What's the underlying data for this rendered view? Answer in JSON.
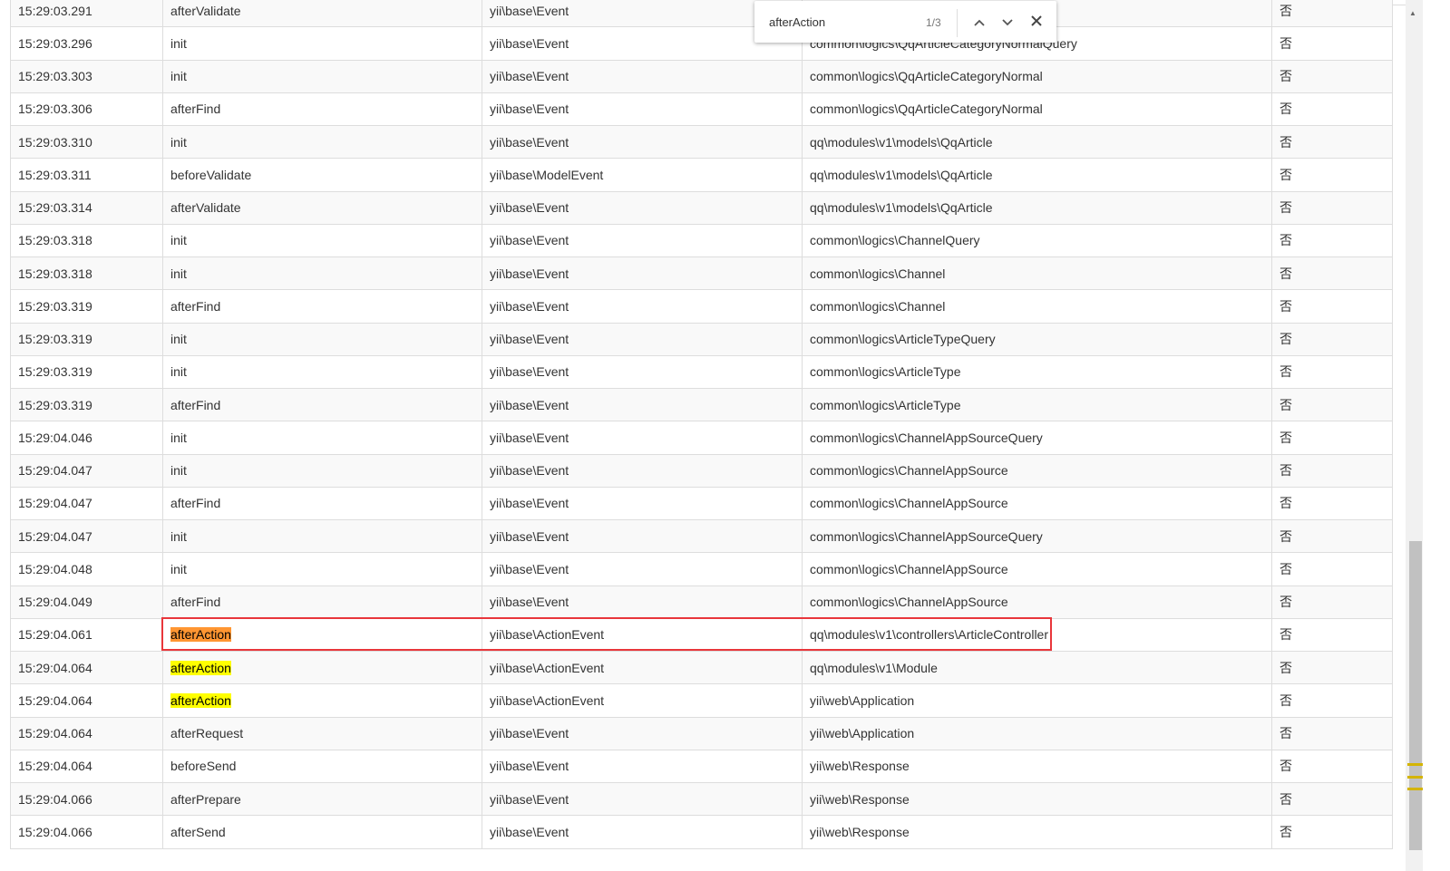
{
  "find_bar": {
    "query": "afterAction",
    "count": "1/3",
    "prev_icon": "chevron-up-icon",
    "next_icon": "chevron-down-icon",
    "close_icon": "close-icon"
  },
  "colors": {
    "match": "#ffff00",
    "current_match": "#ff9632",
    "selection_box": "#e8363b"
  },
  "rows": [
    {
      "time": "15:29:03.291",
      "name": "afterValidate",
      "class": "yii\\base\\Event",
      "sender": "",
      "static": "否"
    },
    {
      "time": "15:29:03.296",
      "name": "init",
      "class": "yii\\base\\Event",
      "sender": "common\\logics\\QqArticleCategoryNormalQuery",
      "static": "否"
    },
    {
      "time": "15:29:03.303",
      "name": "init",
      "class": "yii\\base\\Event",
      "sender": "common\\logics\\QqArticleCategoryNormal",
      "static": "否"
    },
    {
      "time": "15:29:03.306",
      "name": "afterFind",
      "class": "yii\\base\\Event",
      "sender": "common\\logics\\QqArticleCategoryNormal",
      "static": "否"
    },
    {
      "time": "15:29:03.310",
      "name": "init",
      "class": "yii\\base\\Event",
      "sender": "qq\\modules\\v1\\models\\QqArticle",
      "static": "否"
    },
    {
      "time": "15:29:03.311",
      "name": "beforeValidate",
      "class": "yii\\base\\ModelEvent",
      "sender": "qq\\modules\\v1\\models\\QqArticle",
      "static": "否"
    },
    {
      "time": "15:29:03.314",
      "name": "afterValidate",
      "class": "yii\\base\\Event",
      "sender": "qq\\modules\\v1\\models\\QqArticle",
      "static": "否"
    },
    {
      "time": "15:29:03.318",
      "name": "init",
      "class": "yii\\base\\Event",
      "sender": "common\\logics\\ChannelQuery",
      "static": "否"
    },
    {
      "time": "15:29:03.318",
      "name": "init",
      "class": "yii\\base\\Event",
      "sender": "common\\logics\\Channel",
      "static": "否"
    },
    {
      "time": "15:29:03.319",
      "name": "afterFind",
      "class": "yii\\base\\Event",
      "sender": "common\\logics\\Channel",
      "static": "否"
    },
    {
      "time": "15:29:03.319",
      "name": "init",
      "class": "yii\\base\\Event",
      "sender": "common\\logics\\ArticleTypeQuery",
      "static": "否"
    },
    {
      "time": "15:29:03.319",
      "name": "init",
      "class": "yii\\base\\Event",
      "sender": "common\\logics\\ArticleType",
      "static": "否"
    },
    {
      "time": "15:29:03.319",
      "name": "afterFind",
      "class": "yii\\base\\Event",
      "sender": "common\\logics\\ArticleType",
      "static": "否"
    },
    {
      "time": "15:29:04.046",
      "name": "init",
      "class": "yii\\base\\Event",
      "sender": "common\\logics\\ChannelAppSourceQuery",
      "static": "否"
    },
    {
      "time": "15:29:04.047",
      "name": "init",
      "class": "yii\\base\\Event",
      "sender": "common\\logics\\ChannelAppSource",
      "static": "否"
    },
    {
      "time": "15:29:04.047",
      "name": "afterFind",
      "class": "yii\\base\\Event",
      "sender": "common\\logics\\ChannelAppSource",
      "static": "否"
    },
    {
      "time": "15:29:04.047",
      "name": "init",
      "class": "yii\\base\\Event",
      "sender": "common\\logics\\ChannelAppSourceQuery",
      "static": "否"
    },
    {
      "time": "15:29:04.048",
      "name": "init",
      "class": "yii\\base\\Event",
      "sender": "common\\logics\\ChannelAppSource",
      "static": "否"
    },
    {
      "time": "15:29:04.049",
      "name": "afterFind",
      "class": "yii\\base\\Event",
      "sender": "common\\logics\\ChannelAppSource",
      "static": "否"
    },
    {
      "time": "15:29:04.061",
      "name": "afterAction",
      "class": "yii\\base\\ActionEvent",
      "sender": "qq\\modules\\v1\\controllers\\ArticleController",
      "static": "否",
      "match": "current"
    },
    {
      "time": "15:29:04.064",
      "name": "afterAction",
      "class": "yii\\base\\ActionEvent",
      "sender": "qq\\modules\\v1\\Module",
      "static": "否",
      "match": "yes"
    },
    {
      "time": "15:29:04.064",
      "name": "afterAction",
      "class": "yii\\base\\ActionEvent",
      "sender": "yii\\web\\Application",
      "static": "否",
      "match": "yes"
    },
    {
      "time": "15:29:04.064",
      "name": "afterRequest",
      "class": "yii\\base\\Event",
      "sender": "yii\\web\\Application",
      "static": "否"
    },
    {
      "time": "15:29:04.064",
      "name": "beforeSend",
      "class": "yii\\base\\Event",
      "sender": "yii\\web\\Response",
      "static": "否"
    },
    {
      "time": "15:29:04.066",
      "name": "afterPrepare",
      "class": "yii\\base\\Event",
      "sender": "yii\\web\\Response",
      "static": "否"
    },
    {
      "time": "15:29:04.066",
      "name": "afterSend",
      "class": "yii\\base\\Event",
      "sender": "yii\\web\\Response",
      "static": "否"
    }
  ]
}
